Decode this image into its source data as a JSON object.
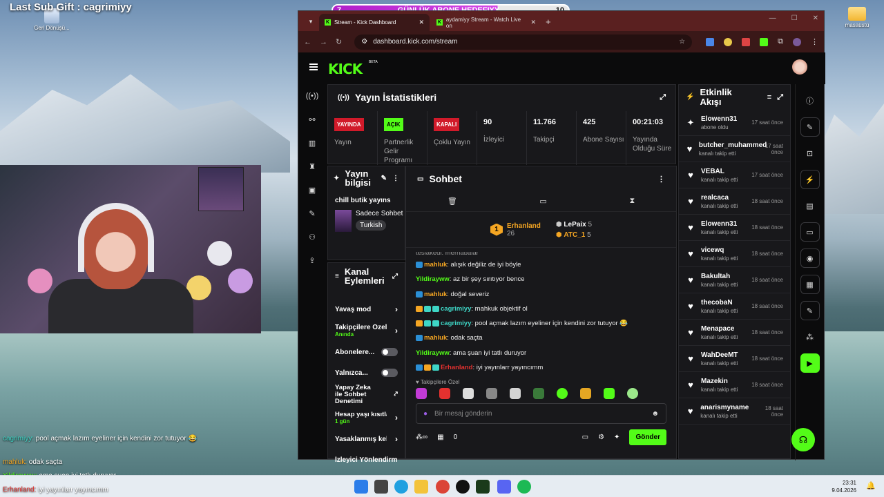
{
  "desktop": {
    "recycle_bin_label": "Geri Dönüşü...",
    "folder_label": "masaüstü"
  },
  "overlay": {
    "last_sub_gift": "Last Sub Gift : cagrimiyy",
    "goal_title": "GÜNLÜK ABONE HEDEFIYY",
    "goal_current": "7",
    "goal_target": "10",
    "goal_progress_fraction": 0.7,
    "chat_lines": [
      {
        "name": "cagrimiyy:",
        "text": " pool açmak lazım eyeliner için kendini zor tutuyor 😂"
      },
      {
        "name": "mahluk:",
        "text": " odak saçta"
      },
      {
        "name": "Yildirayww:",
        "text": " ama şuan iyi tatlı duruyor"
      },
      {
        "name": "Erhanland:",
        "text": " iyi yayınlarr yayıncımm"
      }
    ]
  },
  "taskbar": {
    "time": "23:31",
    "date": "9.04.2026"
  },
  "browser": {
    "tabs": [
      {
        "title": "Stream - Kick Dashboard"
      },
      {
        "title": "aydamiyy Stream - Watch Live on"
      }
    ],
    "url": "dashboard.kick.com/stream"
  },
  "kick": {
    "logo": "KICK",
    "beta": "BETA"
  },
  "stats": {
    "title": "Yayın İstatistikleri",
    "items": [
      {
        "tag": "YAYINDA",
        "label": "Yayın"
      },
      {
        "tag": "AÇIK",
        "label": "Partnerlik Gelir Programı"
      },
      {
        "tag": "KAPALI",
        "label": "Çoklu Yayın"
      },
      {
        "value": "90",
        "label": "İzleyici"
      },
      {
        "value": "11.766",
        "label": "Takipçi"
      },
      {
        "value": "425",
        "label": "Abone Sayısı"
      },
      {
        "value": "00:21:03",
        "label": "Yayında Olduğu Süre"
      }
    ]
  },
  "stream_info": {
    "title": "Yayın bilgisi",
    "stream_title": "chill butik yayıns",
    "category": "Sadece Sohbet",
    "language": "Turkish"
  },
  "channel_actions": {
    "title": "Kanal Eylemleri",
    "items": [
      {
        "label": "Yavaş mod"
      },
      {
        "label": "Takipçilere Özel",
        "sub": "Anında"
      },
      {
        "label": "Abonelere..."
      },
      {
        "label": "Yalnızca..."
      },
      {
        "label": "Yapay Zeka ile Sohbet Denetimi"
      },
      {
        "label": "Hesap yaşı kısıtlaması",
        "sub": "1 gün"
      },
      {
        "label": "Yasaklanmış kelimeler"
      },
      {
        "label": "İzleyici Yönlendirme"
      }
    ]
  },
  "chat": {
    "title": "Sohbet",
    "leaders": [
      {
        "rank": "1",
        "name": "Erhanland",
        "count": "26"
      },
      {
        "name": "LePaix",
        "count": "5"
      },
      {
        "name": "ATC_1",
        "count": "5"
      }
    ],
    "partial_line": "teslakedi: merhabalar",
    "messages": [
      {
        "name": "mahluk",
        "color": "#f5a623",
        "text": "alışık değiliz de iyi böyle"
      },
      {
        "name": "Yildirayww",
        "color": "#53fc18",
        "text": "az bir şey sırıtıyor bence"
      },
      {
        "name": "mahluk",
        "color": "#f5a623",
        "text": "doğal severiz"
      },
      {
        "name": "cagrimiyy",
        "color": "#3ed6c6",
        "text": "mahkuk objektif ol"
      },
      {
        "name": "cagrimiyy",
        "color": "#3ed6c6",
        "text": "pool açmak lazım eyeliner için kendini zor tutuyor 😂"
      },
      {
        "name": "mahluk",
        "color": "#f5a623",
        "text": "odak saçta"
      },
      {
        "name": "Yildirayww",
        "color": "#53fc18",
        "text": "ama şuan iyi tatlı duruyor"
      },
      {
        "name": "Erhanland",
        "color": "#e5312f",
        "text": "iyi yayınlarr yayıncımm"
      }
    ],
    "emote_label": "Takipçilere Özel",
    "input_placeholder": "Bir mesaj gönderin",
    "points": "0",
    "send_label": "Gönder"
  },
  "activity": {
    "title": "Etkinlik Akışı",
    "items": [
      {
        "name": "Elowenn31",
        "action": "abone oldu",
        "time": "17 saat önce",
        "icon": "star-icon"
      },
      {
        "name": "butcher_muhammed",
        "action": "kanalı takip etti",
        "time": "17 saat önce",
        "icon": "heart-icon"
      },
      {
        "name": "VEBAL",
        "action": "kanalı takip etti",
        "time": "17 saat önce",
        "icon": "heart-icon"
      },
      {
        "name": "realcaca",
        "action": "kanalı takip etti",
        "time": "18 saat önce",
        "icon": "heart-icon"
      },
      {
        "name": "Elowenn31",
        "action": "kanalı takip etti",
        "time": "18 saat önce",
        "icon": "heart-icon"
      },
      {
        "name": "vicewq",
        "action": "kanalı takip etti",
        "time": "18 saat önce",
        "icon": "heart-icon"
      },
      {
        "name": "Bakultah",
        "action": "kanalı takip etti",
        "time": "18 saat önce",
        "icon": "heart-icon"
      },
      {
        "name": "thecobaN",
        "action": "kanalı takip etti",
        "time": "18 saat önce",
        "icon": "heart-icon"
      },
      {
        "name": "Menapace",
        "action": "kanalı takip etti",
        "time": "18 saat önce",
        "icon": "heart-icon"
      },
      {
        "name": "WahDeeMT",
        "action": "kanalı takip etti",
        "time": "18 saat önce",
        "icon": "heart-icon"
      },
      {
        "name": "Mazekin",
        "action": "kanalı takip etti",
        "time": "18 saat önce",
        "icon": "heart-icon"
      },
      {
        "name": "anarismyname",
        "action": "kanalı takip etti",
        "time": "18 saat önce",
        "icon": "heart-icon"
      }
    ]
  }
}
